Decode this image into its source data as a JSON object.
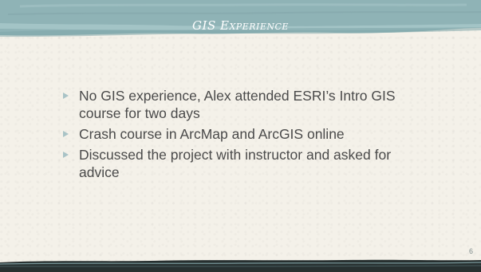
{
  "slide": {
    "title": "GIS Experience",
    "bullets": [
      "No GIS experience, Alex attended ESRI’s Intro GIS course for two days",
      "Crash course in ArcMap and ArcGIS online",
      "Discussed the project with instructor and asked for advice"
    ],
    "page_number": "6"
  },
  "colors": {
    "header": "#8fb3b6",
    "background": "#f4f1e9",
    "text": "#4a4a4a",
    "bullet": "#a9c3c6",
    "footer": "#273030"
  }
}
